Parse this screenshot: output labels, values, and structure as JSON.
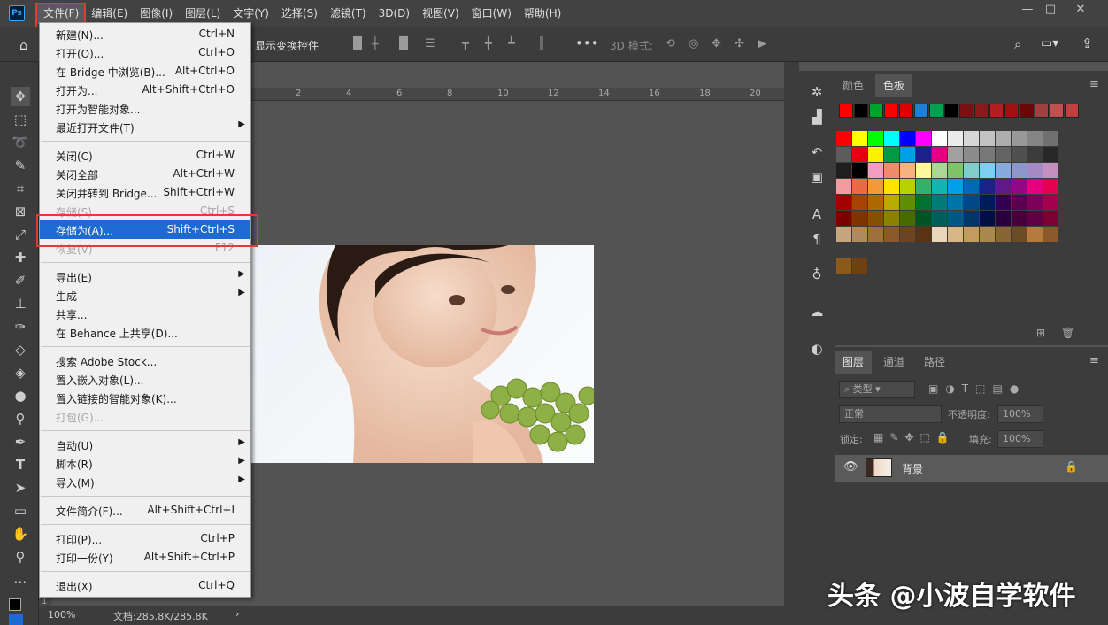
{
  "menubar": {
    "logo": "Ps",
    "items": [
      "文件(F)",
      "编辑(E)",
      "图像(I)",
      "图层(L)",
      "文字(Y)",
      "选择(S)",
      "滤镜(T)",
      "3D(D)",
      "视图(V)",
      "窗口(W)",
      "帮助(H)"
    ]
  },
  "window": {
    "minimize": "—",
    "maximize": "□",
    "close": "✕"
  },
  "options": {
    "transform_controls": "显示变换控件",
    "mode_3d": "3D 模式:"
  },
  "ruler": {
    "ticks": [
      "2",
      "4",
      "6",
      "8",
      "10",
      "12",
      "14",
      "16",
      "18",
      "20"
    ],
    "left": "1"
  },
  "status": {
    "zoom": "100%",
    "doc": "文档:285.8K/285.8K"
  },
  "file_menu": [
    {
      "label": "新建(N)...",
      "shortcut": "Ctrl+N"
    },
    {
      "label": "打开(O)...",
      "shortcut": "Ctrl+O"
    },
    {
      "label": "在 Bridge 中浏览(B)...",
      "shortcut": "Alt+Ctrl+O"
    },
    {
      "label": "打开为...",
      "shortcut": "Alt+Shift+Ctrl+O"
    },
    {
      "label": "打开为智能对象...",
      "shortcut": ""
    },
    {
      "label": "最近打开文件(T)",
      "shortcut": "",
      "submenu": true
    },
    {
      "sep": true
    },
    {
      "label": "关闭(C)",
      "shortcut": "Ctrl+W"
    },
    {
      "label": "关闭全部",
      "shortcut": "Alt+Ctrl+W"
    },
    {
      "label": "关闭并转到 Bridge...",
      "shortcut": "Shift+Ctrl+W"
    },
    {
      "label": "存储(S)",
      "shortcut": "Ctrl+S",
      "disabled": true
    },
    {
      "label": "存储为(A)...",
      "shortcut": "Shift+Ctrl+S",
      "highlight": true
    },
    {
      "label": "恢复(V)",
      "shortcut": "F12",
      "disabled": true
    },
    {
      "sep": true
    },
    {
      "label": "导出(E)",
      "shortcut": "",
      "submenu": true
    },
    {
      "label": "生成",
      "shortcut": "",
      "submenu": true
    },
    {
      "label": "共享...",
      "shortcut": ""
    },
    {
      "label": "在 Behance 上共享(D)...",
      "shortcut": ""
    },
    {
      "sep": true
    },
    {
      "label": "搜索 Adobe Stock...",
      "shortcut": ""
    },
    {
      "label": "置入嵌入对象(L)...",
      "shortcut": ""
    },
    {
      "label": "置入链接的智能对象(K)...",
      "shortcut": ""
    },
    {
      "label": "打包(G)...",
      "shortcut": "",
      "disabled": true
    },
    {
      "sep": true
    },
    {
      "label": "自动(U)",
      "shortcut": "",
      "submenu": true
    },
    {
      "label": "脚本(R)",
      "shortcut": "",
      "submenu": true
    },
    {
      "label": "导入(M)",
      "shortcut": "",
      "submenu": true
    },
    {
      "sep": true
    },
    {
      "label": "文件简介(F)...",
      "shortcut": "Alt+Shift+Ctrl+I"
    },
    {
      "sep": true
    },
    {
      "label": "打印(P)...",
      "shortcut": "Ctrl+P"
    },
    {
      "label": "打印一份(Y)",
      "shortcut": "Alt+Shift+Ctrl+P"
    },
    {
      "sep": true
    },
    {
      "label": "退出(X)",
      "shortcut": "Ctrl+Q"
    }
  ],
  "color_panel": {
    "tabs": [
      "颜色",
      "色板"
    ],
    "recent": [
      "#ff0000",
      "#000000",
      "#00a32a",
      "#ff0000",
      "#e00000",
      "#1e7fd8",
      "#00a050",
      "#000000",
      "#7a1010",
      "#8a1a1a",
      "#b02020",
      "#a01010",
      "#6a0808",
      "#a04040",
      "#c05050",
      "#c04040"
    ],
    "swatches": [
      "#ff0000",
      "#ffff00",
      "#00ff00",
      "#00ffff",
      "#0000ff",
      "#ff00ff",
      "#ffffff",
      "#ebebeb",
      "#d6d6d6",
      "#c2c2c2",
      "#adadad",
      "#999999",
      "#858585",
      "#707070",
      "#5c5c5c",
      "#e60012",
      "#fff100",
      "#009944",
      "#009fe8",
      "#1d2088",
      "#e4007f",
      "#a0a0a0",
      "#8c8c8c",
      "#787878",
      "#646464",
      "#505050",
      "#3c3c3c",
      "#282828",
      "#1e1e1e",
      "#000000",
      "#f19ec2",
      "#f08b6b",
      "#f6b37f",
      "#fff799",
      "#acd598",
      "#80c269",
      "#84ccc9",
      "#7ecef4",
      "#88abda",
      "#8c97cb",
      "#a489c4",
      "#c490bf",
      "#f29c9f",
      "#ec6941",
      "#f29b36",
      "#fce300",
      "#b8d200",
      "#32b16c",
      "#13b5b1",
      "#00a0e9",
      "#0068b7",
      "#1d2088",
      "#601986",
      "#920783",
      "#e4007f",
      "#e5004f",
      "#a40000",
      "#a84200",
      "#ac6a00",
      "#b7aa00",
      "#5f8f00",
      "#007130",
      "#007b77",
      "#0075a9",
      "#004986",
      "#001c58",
      "#32004f",
      "#5a004f",
      "#7e0058",
      "#a4004c",
      "#7d0000",
      "#7f3300",
      "#835100",
      "#8b8100",
      "#486b00",
      "#005324",
      "#005e5a",
      "#005982",
      "#003567",
      "#000e40",
      "#28003b",
      "#440039",
      "#600042",
      "#7d0032",
      "#c5a681",
      "#ae8a60",
      "#9c7040",
      "#8b5a2b",
      "#6c4323",
      "#5a3214",
      "#ead6b8",
      "#d9b687",
      "#c29b62",
      "#a98750",
      "#876536",
      "#6a4c25",
      "#b47c3c",
      "#8b5a2b"
    ]
  },
  "layers_panel": {
    "tabs": [
      "图层",
      "通道",
      "路径"
    ],
    "kind": "类型",
    "blend": "正常",
    "opacity_label": "不透明度:",
    "opacity": "100%",
    "lock_label": "锁定:",
    "fill_label": "填充:",
    "fill": "100%",
    "layer_name": "背景"
  },
  "watermark": "头条 @小波自学软件"
}
